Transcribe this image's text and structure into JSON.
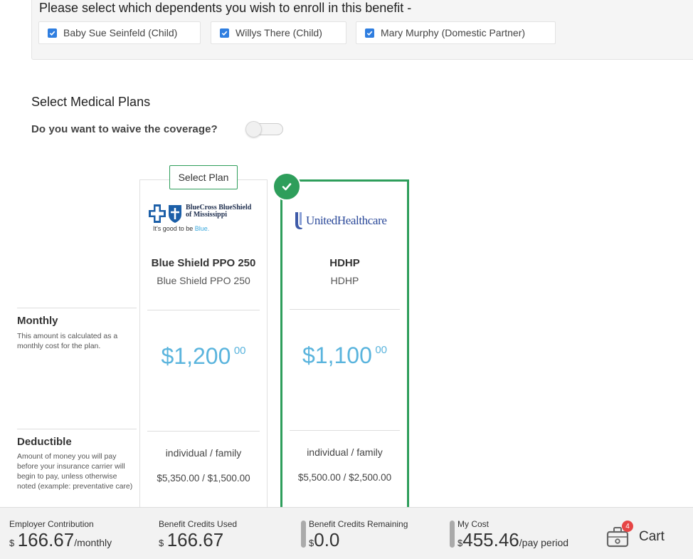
{
  "dependents": {
    "title": "Please select which dependents you wish to enroll in this benefit -",
    "items": [
      {
        "label": "Baby Sue Seinfeld (Child)",
        "checked": true
      },
      {
        "label": "Willys There (Child)",
        "checked": true
      },
      {
        "label": "Mary Murphy (Domestic Partner)",
        "checked": true
      }
    ]
  },
  "medical": {
    "title": "Select Medical Plans",
    "waive_label": "Do you want to waive the coverage?",
    "waive_on": false
  },
  "rows": {
    "monthly": {
      "title": "Monthly",
      "desc": "This amount is calculated as a monthly cost for the plan."
    },
    "deductible": {
      "title": "Deductible",
      "desc": "Amount of money you will pay before your insurance carrier will begin to pay, unless otherwise noted (example: preventative care)"
    }
  },
  "plans": [
    {
      "action": "Select Plan",
      "carrier_line1": "BlueCross BlueShield",
      "carrier_line2": "of Mississippi",
      "tagline_prefix": "It's good to be ",
      "tagline_accent": "Blue.",
      "name": "Blue Shield PPO 250",
      "sub": "Blue Shield PPO 250",
      "price_dollars": "$1,200",
      "price_cents": "00",
      "ded_head": "individual / family",
      "ded_values": "$5,350.00 / $1,500.00",
      "selected": false
    },
    {
      "carrier": "UnitedHealthcare",
      "name": "HDHP",
      "sub": "HDHP",
      "price_dollars": "$1,100",
      "price_cents": "00",
      "ded_head": "individual / family",
      "ded_values": "$5,500.00 / $2,500.00",
      "selected": true
    }
  ],
  "footer": {
    "employer": {
      "label": "Employer Contribution",
      "cur": "$",
      "value": "166.67",
      "unit": "/monthly"
    },
    "credits_used": {
      "label": "Benefit Credits Used",
      "cur": "$",
      "value": "166.67"
    },
    "credits_remaining": {
      "label": "Benefit Credits Remaining",
      "cur": "$",
      "value": "0.0"
    },
    "my_cost": {
      "label": "My Cost",
      "cur": "$",
      "value": "455.46",
      "unit": "/pay period"
    },
    "cart": {
      "label": "Cart",
      "count": "4"
    }
  },
  "colors": {
    "accent_green": "#2e9e5b",
    "price_blue": "#5ab4dd",
    "checkbox_blue": "#2f7ee0",
    "badge_red": "#e64545"
  }
}
